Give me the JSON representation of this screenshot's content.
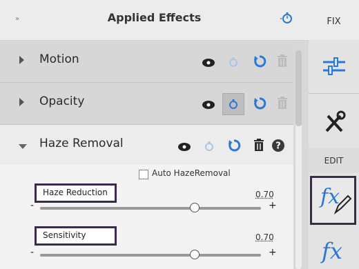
{
  "header": {
    "collapse_glyph": "»",
    "title": "Applied Effects",
    "fix_label": "FIX"
  },
  "effects": [
    {
      "label": "Motion"
    },
    {
      "label": "Opacity"
    },
    {
      "label": "Haze Removal"
    }
  ],
  "haze": {
    "auto_label": "Auto HazeRemoval",
    "params": [
      {
        "label": "Haze Reduction",
        "value": "0.70",
        "level": 0.7
      },
      {
        "label": "Sensitivity",
        "value": "0.70",
        "level": 0.7
      }
    ]
  },
  "sidebar": {
    "edit_label": "EDIT",
    "fx_text": "fx"
  },
  "slider_marks": {
    "minus": "-",
    "plus": "+"
  },
  "colors": {
    "accent_blue": "#2a78d6",
    "highlight": "#3c2a4d"
  },
  "icons": [
    "eye-icon",
    "stopwatch-icon",
    "reset-icon",
    "trash-icon",
    "help-icon",
    "sliders-icon",
    "tools-icon",
    "fx-brush-icon",
    "fx-icon"
  ]
}
